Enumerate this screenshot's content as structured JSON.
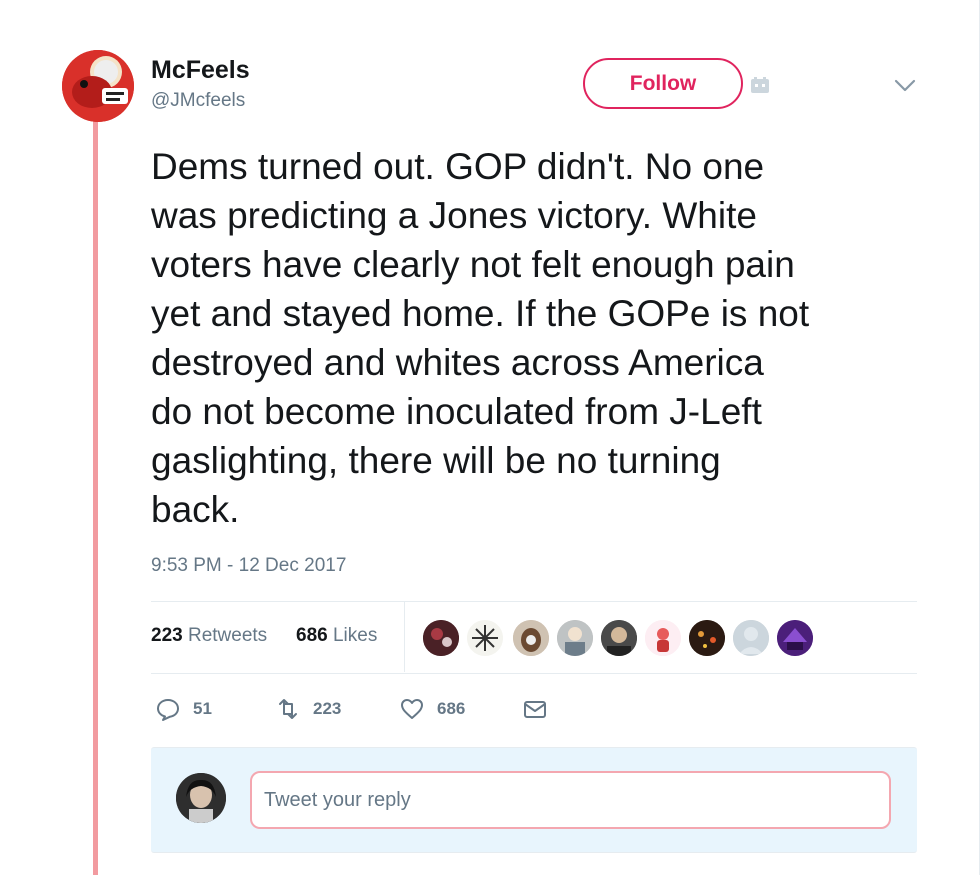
{
  "user": {
    "display_name": "McFeels",
    "handle": "@JMcfeels"
  },
  "follow_button": {
    "label": "Follow"
  },
  "tweet": {
    "text": "Dems turned out. GOP didn't. No one\nwas predicting a Jones victory. White\nvoters have clearly not felt enough pain\nyet and stayed home. If the GOPe is not\ndestroyed and whites across America\ndo not become inoculated from J-Left\ngaslighting, there will be no turning\nback.",
    "timestamp": "9:53 PM - 12 Dec 2017"
  },
  "stats": {
    "retweets_count": "223",
    "retweets_label": "Retweets",
    "likes_count": "686",
    "likes_label": "Likes"
  },
  "likers": [
    "liker-avatar",
    "liker-avatar",
    "liker-avatar",
    "liker-avatar",
    "liker-avatar",
    "liker-avatar",
    "liker-avatar",
    "liker-avatar",
    "liker-avatar"
  ],
  "actions": {
    "reply_count": "51",
    "retweet_count": "223",
    "like_count": "686"
  },
  "reply": {
    "placeholder": "Tweet your reply"
  },
  "colors": {
    "follow_accent": "#e0245e",
    "thread_line": "#f29ba0",
    "secondary_text": "#657786",
    "reply_area": "#e8f5fd"
  }
}
